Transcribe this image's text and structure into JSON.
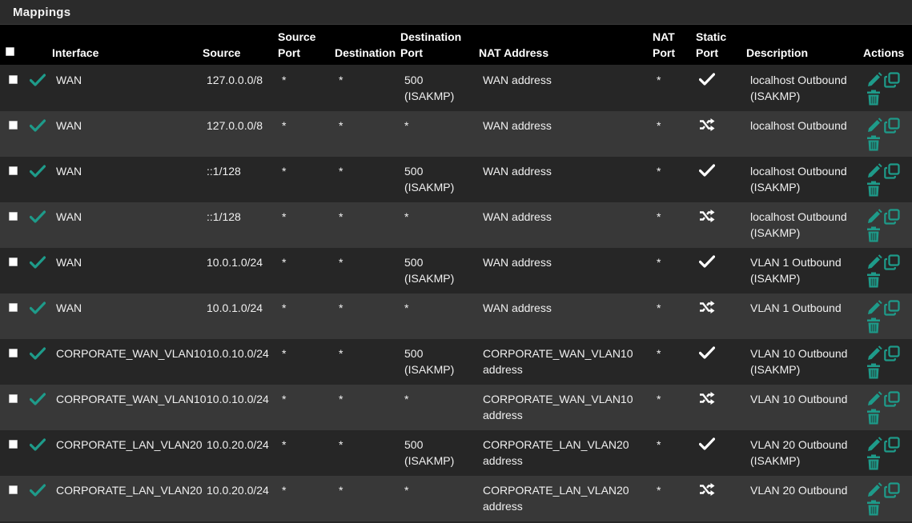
{
  "panel": {
    "title": "Mappings"
  },
  "headers": {
    "interface": "Interface",
    "source": "Source",
    "source_port": [
      "Source",
      "Port"
    ],
    "destination": "Destination",
    "destination_port": [
      "Destination",
      "Port"
    ],
    "nat_address": "NAT Address",
    "nat_port": [
      "NAT",
      "Port"
    ],
    "static_port": [
      "Static",
      "Port"
    ],
    "description": "Description",
    "actions": "Actions"
  },
  "colors": {
    "accent": "#1e9b8a",
    "header_bg": "#000000",
    "row_dark": "#262626",
    "row_light": "#383838"
  },
  "rows": [
    {
      "enabled_icon": "check-icon",
      "interface": "WAN",
      "source": "127.0.0.0/8",
      "source_port": "*",
      "destination": "*",
      "destination_port": [
        "500",
        "(ISAKMP)"
      ],
      "nat_address": [
        "WAN address",
        ""
      ],
      "nat_port": "*",
      "static_port_icon": "check-icon",
      "description": [
        "localhost Outbound",
        "(ISAKMP)"
      ]
    },
    {
      "enabled_icon": "check-icon",
      "interface": "WAN",
      "source": "127.0.0.0/8",
      "source_port": "*",
      "destination": "*",
      "destination_port": [
        "*",
        ""
      ],
      "nat_address": [
        "WAN address",
        ""
      ],
      "nat_port": "*",
      "static_port_icon": "shuffle-icon",
      "description": [
        "localhost Outbound",
        ""
      ]
    },
    {
      "enabled_icon": "check-icon",
      "interface": "WAN",
      "source": "::1/128",
      "source_port": "*",
      "destination": "*",
      "destination_port": [
        "500",
        "(ISAKMP)"
      ],
      "nat_address": [
        "WAN address",
        ""
      ],
      "nat_port": "*",
      "static_port_icon": "check-icon",
      "description": [
        "localhost Outbound",
        "(ISAKMP)"
      ]
    },
    {
      "enabled_icon": "check-icon",
      "interface": "WAN",
      "source": "::1/128",
      "source_port": "*",
      "destination": "*",
      "destination_port": [
        "*",
        ""
      ],
      "nat_address": [
        "WAN address",
        ""
      ],
      "nat_port": "*",
      "static_port_icon": "shuffle-icon",
      "description": [
        "localhost Outbound",
        "(ISAKMP)"
      ]
    },
    {
      "enabled_icon": "check-icon",
      "interface": "WAN",
      "source": "10.0.1.0/24",
      "source_port": "*",
      "destination": "*",
      "destination_port": [
        "500",
        "(ISAKMP)"
      ],
      "nat_address": [
        "WAN address",
        ""
      ],
      "nat_port": "*",
      "static_port_icon": "check-icon",
      "description": [
        "VLAN 1 Outbound",
        "(ISAKMP)"
      ]
    },
    {
      "enabled_icon": "check-icon",
      "interface": "WAN",
      "source": "10.0.1.0/24",
      "source_port": "*",
      "destination": "*",
      "destination_port": [
        "*",
        ""
      ],
      "nat_address": [
        "WAN address",
        ""
      ],
      "nat_port": "*",
      "static_port_icon": "shuffle-icon",
      "description": [
        "VLAN 1 Outbound",
        ""
      ]
    },
    {
      "enabled_icon": "check-icon",
      "interface": "CORPORATE_WAN_VLAN10",
      "source": "10.0.10.0/24",
      "source_port": "*",
      "destination": "*",
      "destination_port": [
        "500",
        "(ISAKMP)"
      ],
      "nat_address": [
        "CORPORATE_WAN_VLAN10",
        "address"
      ],
      "nat_port": "*",
      "static_port_icon": "check-icon",
      "description": [
        "VLAN 10 Outbound",
        "(ISAKMP)"
      ]
    },
    {
      "enabled_icon": "check-icon",
      "interface": "CORPORATE_WAN_VLAN10",
      "source": "10.0.10.0/24",
      "source_port": "*",
      "destination": "*",
      "destination_port": [
        "*",
        ""
      ],
      "nat_address": [
        "CORPORATE_WAN_VLAN10",
        "address"
      ],
      "nat_port": "*",
      "static_port_icon": "shuffle-icon",
      "description": [
        "VLAN 10 Outbound",
        ""
      ]
    },
    {
      "enabled_icon": "check-icon",
      "interface": "CORPORATE_LAN_VLAN20",
      "source": "10.0.20.0/24",
      "source_port": "*",
      "destination": "*",
      "destination_port": [
        "500",
        "(ISAKMP)"
      ],
      "nat_address": [
        "CORPORATE_LAN_VLAN20",
        "address"
      ],
      "nat_port": "*",
      "static_port_icon": "check-icon",
      "description": [
        "VLAN 20 Outbound",
        "(ISAKMP)"
      ]
    },
    {
      "enabled_icon": "check-icon",
      "interface": "CORPORATE_LAN_VLAN20",
      "source": "10.0.20.0/24",
      "source_port": "*",
      "destination": "*",
      "destination_port": [
        "*",
        ""
      ],
      "nat_address": [
        "CORPORATE_LAN_VLAN20",
        "address"
      ],
      "nat_port": "*",
      "static_port_icon": "shuffle-icon",
      "description": [
        "VLAN 20 Outbound",
        ""
      ]
    }
  ]
}
